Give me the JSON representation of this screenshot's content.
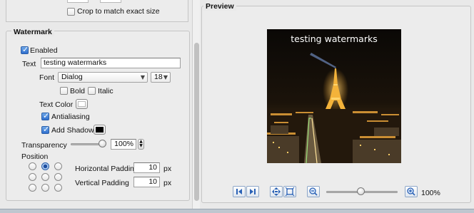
{
  "crop": {
    "label": "Crop to match exact size",
    "checked": false
  },
  "watermark": {
    "section_title": "Watermark",
    "enabled_label": "Enabled",
    "enabled": true,
    "text_label": "Text",
    "text_value": "testing watermarks",
    "font_label": "Font",
    "font_value": "Dialog",
    "font_size": "18",
    "bold_label": "Bold",
    "bold": false,
    "italic_label": "Italic",
    "italic": false,
    "text_color_label": "Text Color",
    "text_color": "#ffffff",
    "antialiasing_label": "Antialiasing",
    "antialiasing": true,
    "shadow_label": "Add Shadow",
    "shadow": true,
    "shadow_color": "#000000",
    "transparency_label": "Transparency",
    "transparency_value": "100%",
    "transparency_fraction": 1.0,
    "position_label": "Position",
    "position_selected": "top-center",
    "h_padding_label": "Horizontal Padding",
    "h_padding_value": "10",
    "v_padding_label": "Vertical Padding",
    "v_padding_value": "10",
    "unit": "px"
  },
  "preview": {
    "section_title": "Preview",
    "watermark_text": "testing watermarks",
    "zoom_value": "100%",
    "zoom_fraction": 0.5,
    "toolbar_icons": [
      "first-icon",
      "last-icon",
      "fit-icon",
      "actual-size-icon",
      "zoom-out-icon",
      "zoom-in-icon"
    ]
  },
  "colors": {
    "accent": "#2f6fce",
    "panel": "#ececec"
  }
}
